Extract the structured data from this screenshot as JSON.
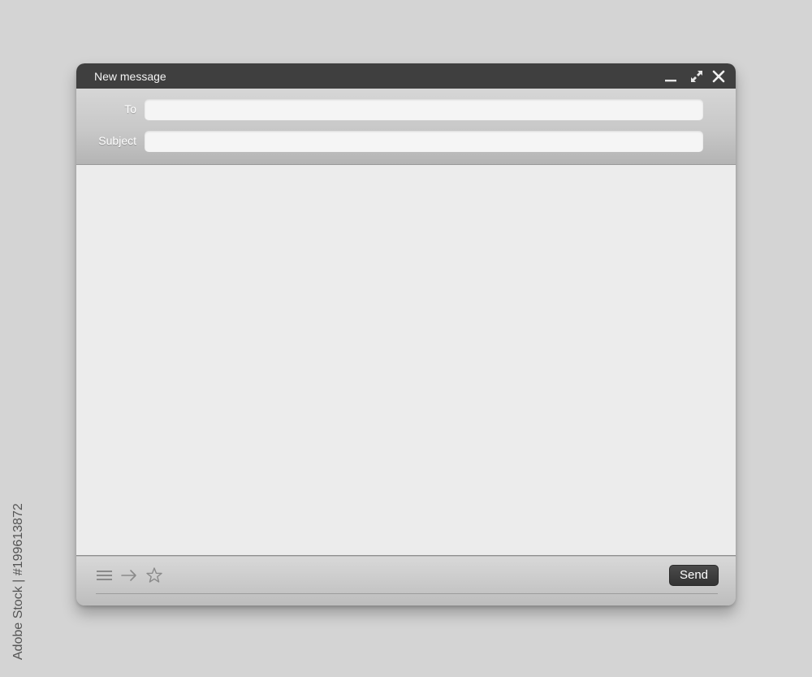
{
  "window": {
    "title": "New message",
    "controls": {
      "minimize": "minimize-icon",
      "expand": "expand-icon",
      "close": "close-icon"
    }
  },
  "compose": {
    "to_label": "To",
    "to_value": "",
    "subject_label": "Subject",
    "subject_value": "",
    "body_value": ""
  },
  "footer": {
    "icons": [
      "menu-icon",
      "forward-arrow-icon",
      "star-icon"
    ],
    "send_label": "Send"
  },
  "credit": {
    "text": "Adobe Stock | #199613872"
  },
  "colors": {
    "titlebar": "#3f3f3f",
    "header": "#c8c8c8",
    "body": "#ececec",
    "send_button": "#3a3a3a",
    "page_background": "#d4d4d4"
  }
}
